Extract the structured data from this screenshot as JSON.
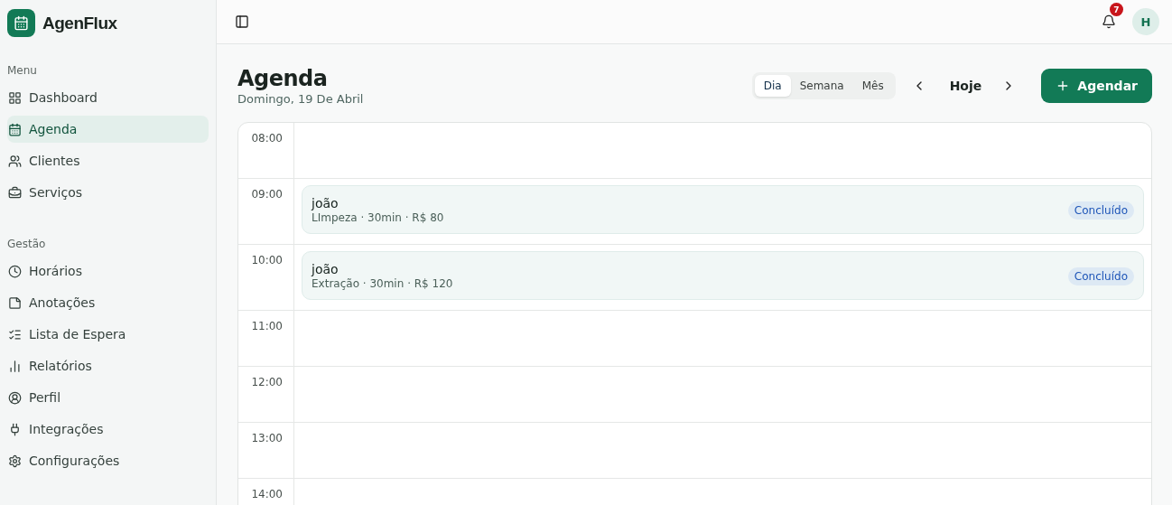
{
  "brand": {
    "name": "AgenFlux"
  },
  "sidebar": {
    "sections": [
      {
        "title": "Menu",
        "items": [
          {
            "label": "Dashboard",
            "selected": false
          },
          {
            "label": "Agenda",
            "selected": true
          },
          {
            "label": "Clientes",
            "selected": false
          },
          {
            "label": "Serviços",
            "selected": false
          }
        ]
      },
      {
        "title": "Gestão",
        "items": [
          {
            "label": "Horários",
            "selected": false
          },
          {
            "label": "Anotações",
            "selected": false
          },
          {
            "label": "Lista de Espera",
            "selected": false
          },
          {
            "label": "Relatórios",
            "selected": false
          },
          {
            "label": "Perfil",
            "selected": false
          },
          {
            "label": "Integrações",
            "selected": false
          },
          {
            "label": "Configurações",
            "selected": false
          }
        ]
      }
    ]
  },
  "header": {
    "notification_count": "7",
    "avatar": "H"
  },
  "page": {
    "title": "Agenda",
    "subtitle": "Domingo, 19 De Abril"
  },
  "view_tabs": [
    {
      "label": "Dia",
      "selected": true
    },
    {
      "label": "Semana",
      "selected": false
    },
    {
      "label": "Mês",
      "selected": false
    }
  ],
  "date_nav": {
    "label": "Hoje"
  },
  "primary_button": {
    "label": "Agendar"
  },
  "slots": [
    {
      "time": "08:00"
    },
    {
      "time": "09:00",
      "appointments": [
        {
          "client": "joão",
          "details": "LImpeza · 30min · R$ 80",
          "status": "Concluído"
        }
      ]
    },
    {
      "time": "10:00",
      "appointments": [
        {
          "client": "joão",
          "details": "Extração · 30min · R$ 120",
          "status": "Concluído"
        }
      ]
    },
    {
      "time": "11:00"
    },
    {
      "time": "12:00"
    },
    {
      "time": "13:00"
    },
    {
      "time": "14:00"
    }
  ]
}
